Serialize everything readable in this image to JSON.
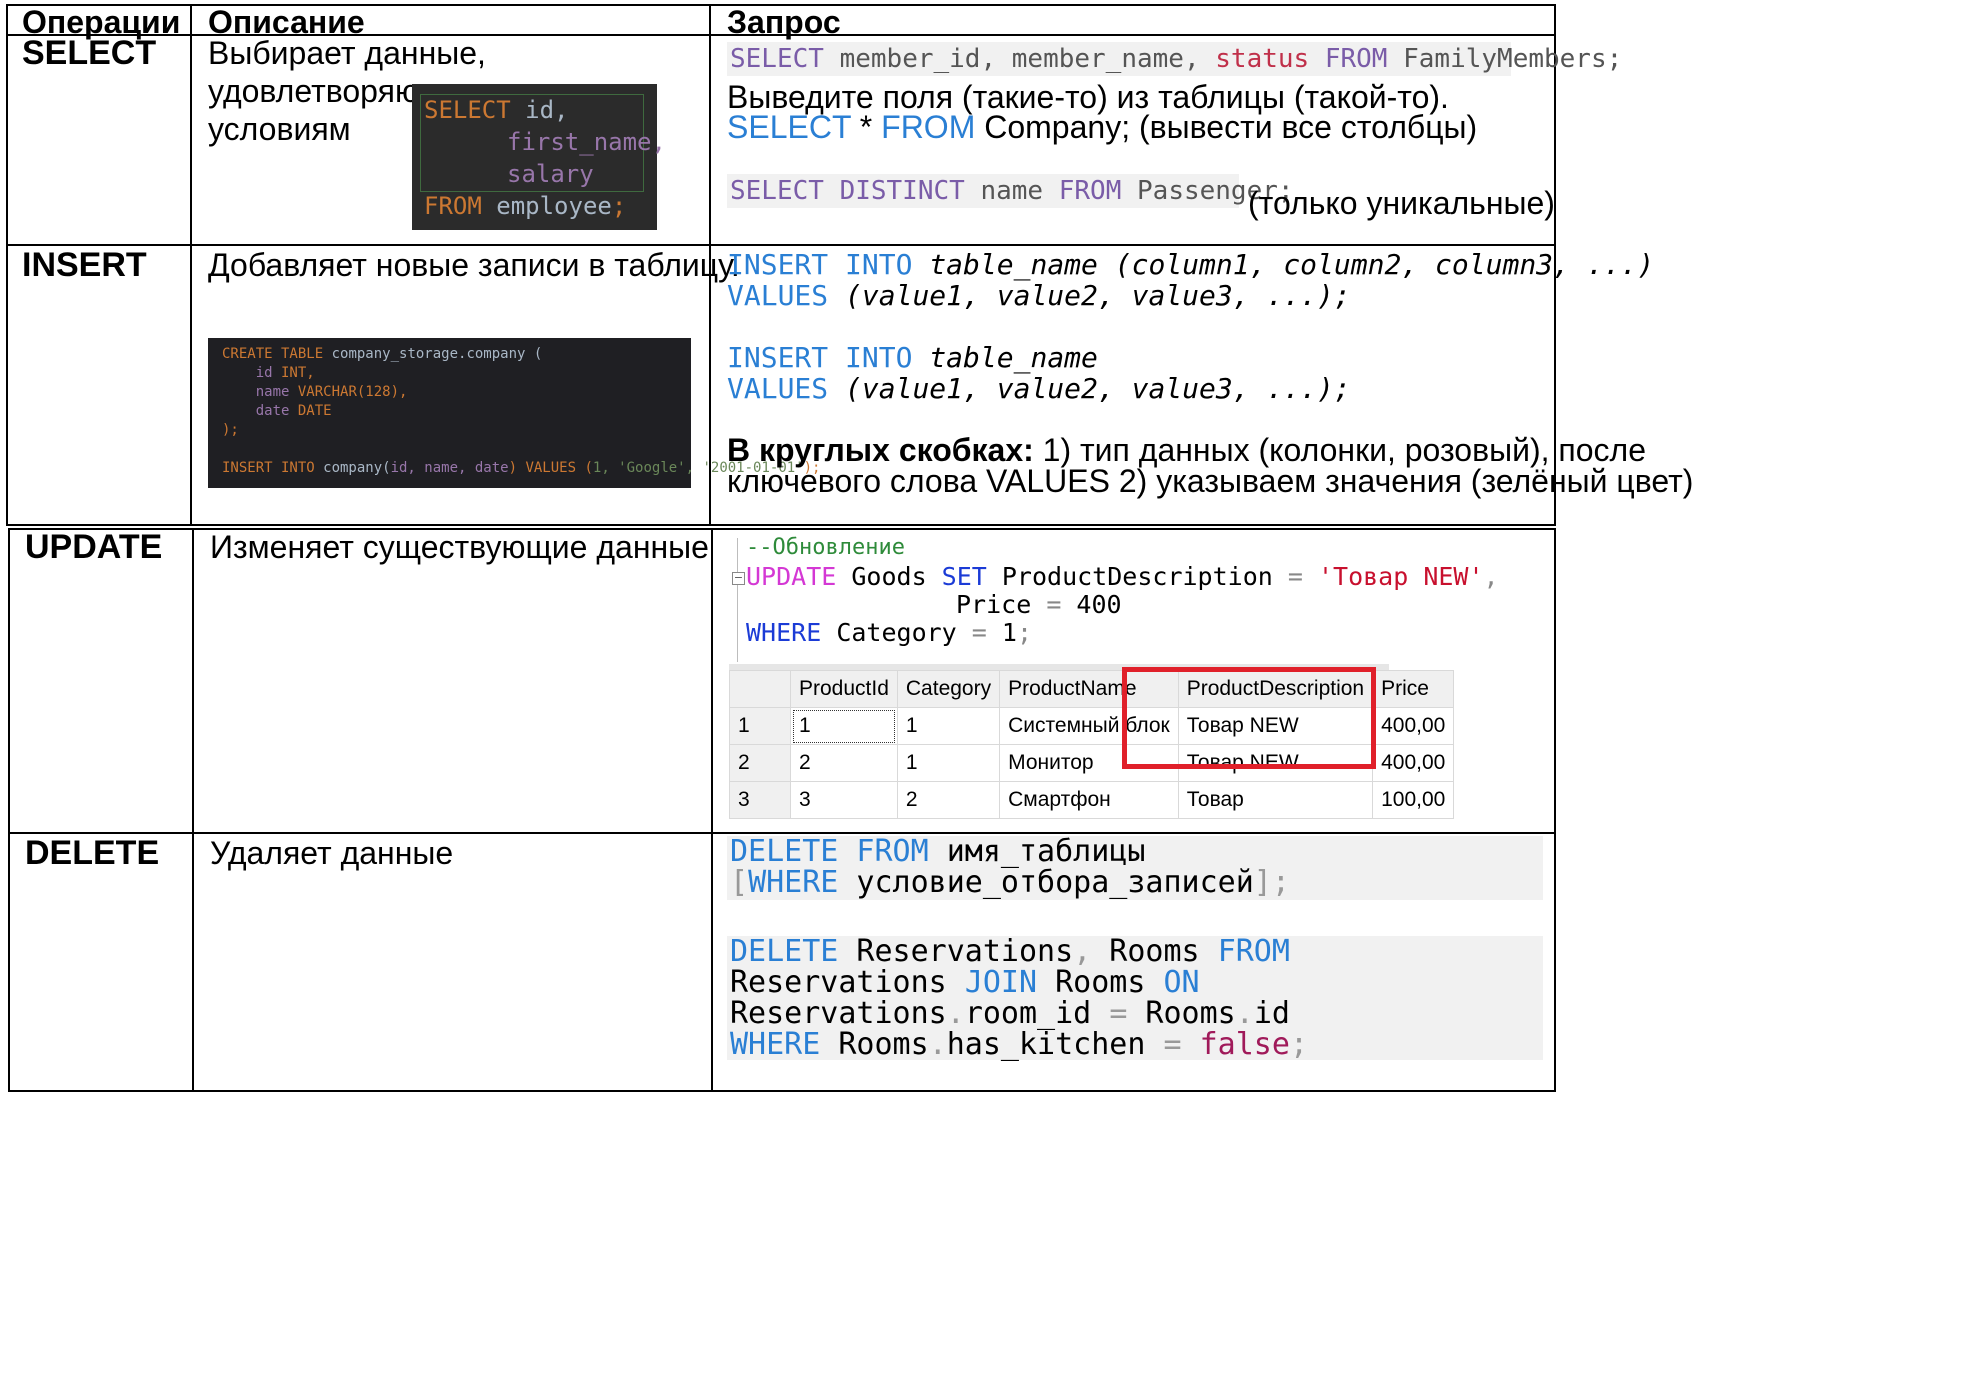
{
  "header": {
    "col1": "Операции",
    "col2": "Описание",
    "col3": "Запрос"
  },
  "rows": {
    "select": {
      "op": "SELECT",
      "desc": "Выбирает данные, удовлетворяющие заданным условиям",
      "code1": {
        "kw1": "SELECT",
        "fields": " member_id, member_name, ",
        "status": "status",
        "kw2": " FROM",
        "rest": " FamilyMembers;"
      },
      "line2": "Выведите поля (такие-то) из таблицы (такой-то).",
      "line3": {
        "kw1": "SELECT",
        "star": " * ",
        "kw2": "FROM",
        "rest": " Company; (вывести все столбцы)"
      },
      "code2": {
        "kw1": "SELECT DISTINCT",
        "name": " name ",
        "kw2": "FROM",
        "rest": " Passenger;"
      },
      "note": "(только уникальные)",
      "image": {
        "l1": {
          "kw": "SELECT",
          "rest": " id,"
        },
        "l2": "first_name,",
        "l3": "salary",
        "l4": {
          "kw": "FROM",
          "rest": " employee",
          "semi": ";"
        }
      }
    },
    "insert": {
      "op": "INSERT",
      "desc": "Добавляет новые записи в таблицу.",
      "code": {
        "l1": {
          "kw1": "INSERT",
          "kw2": " INTO ",
          "tbl": "table_name",
          "cols": " (column1, column2, column3, ...)"
        },
        "l2": {
          "kw": "VALUES",
          "vals": " (value1, value2, value3, ...);"
        },
        "l3": {
          "kw1": "INSERT",
          "kw2": " INTO ",
          "tbl": "table_name"
        },
        "l4": {
          "kw": "VALUES",
          "vals": " (value1, value2, value3, ...);"
        }
      },
      "note_bold": "В круглых скобках:",
      "note_rest": " 1) тип данных (колонки, розовый), после",
      "note_line2": "ключевого слова VALUES 2) указываем значения (зелёный цвет)",
      "image": {
        "l1": {
          "kw": "CREATE TABLE",
          "rest": " company_storage.company ("
        },
        "l2": {
          "name": "    id",
          "type": " INT,"
        },
        "l3": {
          "name": "    name",
          "type": " VARCHAR(128),"
        },
        "l4": {
          "name": "    date",
          "type": " DATE"
        },
        "l5": ");",
        "l6": {
          "kw": "INSERT INTO",
          "tbl": " company(",
          "cols": "id, name, date",
          "kw2": ") VALUES (",
          "vals": "1, 'Google', '2001-01-01'",
          "end": ");"
        }
      }
    },
    "update": {
      "op": "UPDATE",
      "desc": "Изменяет существующие данные",
      "code": {
        "comment": "--Обновление",
        "l1": {
          "kw": "UPDATE",
          "tbl": " Goods ",
          "kw2": "SET",
          "field": " ProductDescription ",
          "eq": "=",
          "val": " 'Товар NEW'",
          "comma": ","
        },
        "l2": {
          "field": "Price ",
          "eq": "=",
          "val": " 400"
        },
        "l3": {
          "kw": "WHERE",
          "field": " Category ",
          "eq": "=",
          "val": " 1",
          "semi": ";"
        }
      },
      "table": {
        "headers": [
          "",
          "ProductId",
          "Category",
          "ProductName",
          "ProductDescription",
          "Price"
        ],
        "rows": [
          [
            "1",
            "1",
            "1",
            "Системный блок",
            "Товар NEW",
            "400,00"
          ],
          [
            "2",
            "2",
            "1",
            "Монитор",
            "Товар NEW",
            "400,00"
          ],
          [
            "3",
            "3",
            "2",
            "Смартфон",
            "Товар",
            "100,00"
          ]
        ]
      }
    },
    "delete": {
      "op": "DELETE",
      "desc": "Удаляет данные",
      "code1": {
        "l1": {
          "kw": "DELETE FROM",
          "rest": " имя_таблицы"
        },
        "l2": {
          "br1": "[",
          "kw": "WHERE",
          "rest": " условие_отбора_записей",
          "br2": "]",
          "semi": ";"
        }
      },
      "code2": {
        "l1": {
          "kw1": "DELETE",
          "t1": " Reservations",
          "c": ",",
          "t2": " Rooms ",
          "kw2": "FROM"
        },
        "l2": {
          "t1": "Reservations ",
          "kw": "JOIN",
          "t2": " Rooms ",
          "kw2": "ON"
        },
        "l3": {
          "t1": "Reservations",
          "dot": ".",
          "f1": "room_id ",
          "eq": "=",
          "t2": " Rooms",
          "dot2": ".",
          "f2": "id"
        },
        "l4": {
          "kw": "WHERE",
          "t1": " Rooms",
          "dot": ".",
          "f1": "has_kitchen ",
          "eq": "=",
          "val": " false",
          "semi": ";"
        }
      }
    }
  }
}
